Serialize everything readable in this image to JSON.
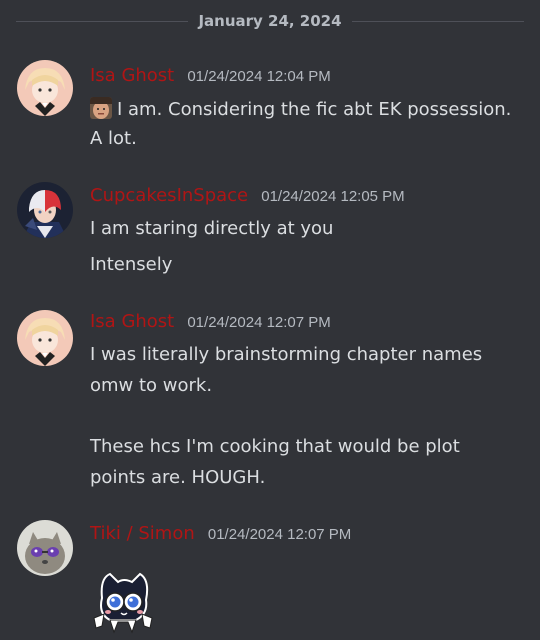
{
  "divider": {
    "date": "January 24, 2024"
  },
  "messages": [
    {
      "username": "Isa Ghost",
      "timestamp": "01/24/2024 12:04 PM",
      "avatar_icon": "anime-character-avatar",
      "lines": [
        "I am. Considering the fic abt EK possession.",
        "A lot."
      ],
      "inline_emoji_icon": "face-emoji"
    },
    {
      "username": "CupcakesInSpace",
      "timestamp": "01/24/2024 12:05 PM",
      "avatar_icon": "red-white-hair-character-avatar",
      "lines": [
        "I am staring directly at you",
        "Intensely"
      ]
    },
    {
      "username": "Isa Ghost",
      "timestamp": "01/24/2024 12:07 PM",
      "avatar_icon": "anime-character-avatar",
      "lines": [
        "I was literally brainstorming chapter names",
        "omw to work.",
        "These hcs I'm cooking that would be plot",
        "points are. HOUGH."
      ]
    },
    {
      "username": "Tiki / Simon",
      "timestamp": "01/24/2024 12:07 PM",
      "avatar_icon": "cat-with-sunglasses-avatar",
      "sticker_icon": "cartoon-cat-sticker"
    }
  ],
  "colors": {
    "background": "#313338",
    "username_red": "#b01515",
    "text": "#dbdee1",
    "muted": "#b5bac1"
  }
}
